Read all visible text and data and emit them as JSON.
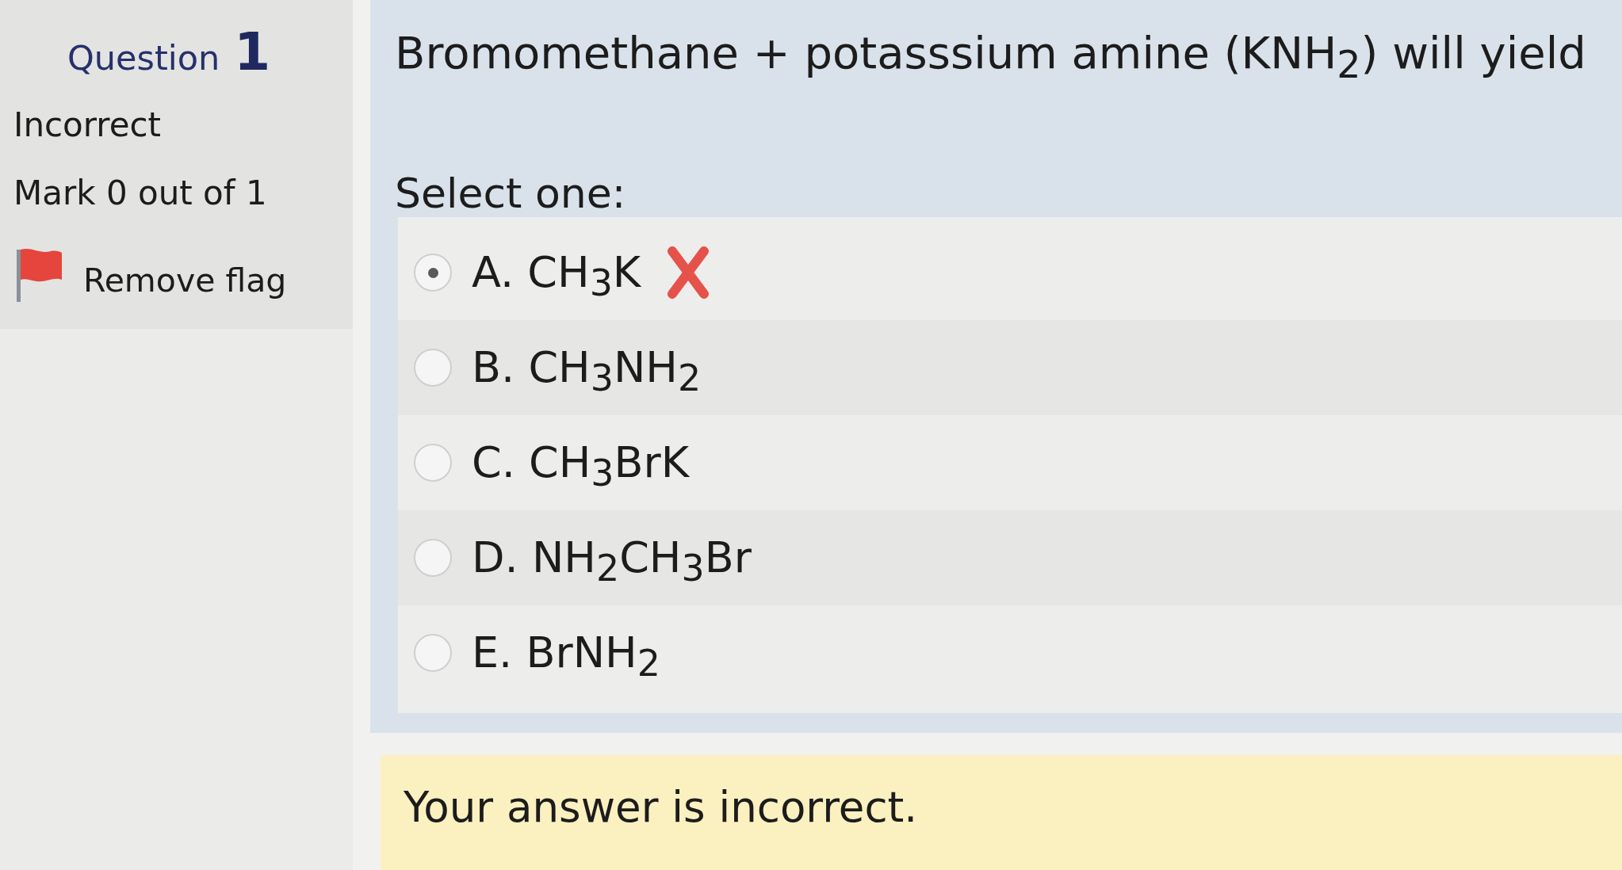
{
  "question_info": {
    "title": "Question",
    "number": "1",
    "status": "Incorrect",
    "mark": "Mark 0 out of 1",
    "flag": {
      "label": "Remove flag",
      "flagged": true
    }
  },
  "question": {
    "text": "Bromomethane + potasssium amine (KNH$_{2}$) will yield",
    "prompt": "Select one:",
    "options": [
      {
        "label": "A. CH$_{3}$K",
        "selected": true,
        "marked_wrong": true
      },
      {
        "label": "B. CH$_{3}$NH$_{2}$",
        "selected": false,
        "marked_wrong": false
      },
      {
        "label": "C. CH$_{3}$BrK",
        "selected": false,
        "marked_wrong": false
      },
      {
        "label": "D. NH$_{2}$CH$_{3}$Br",
        "selected": false,
        "marked_wrong": false
      },
      {
        "label": "E. BrNH$_{2}$",
        "selected": false,
        "marked_wrong": false
      }
    ]
  },
  "feedback": {
    "text": "Your answer is incorrect."
  }
}
